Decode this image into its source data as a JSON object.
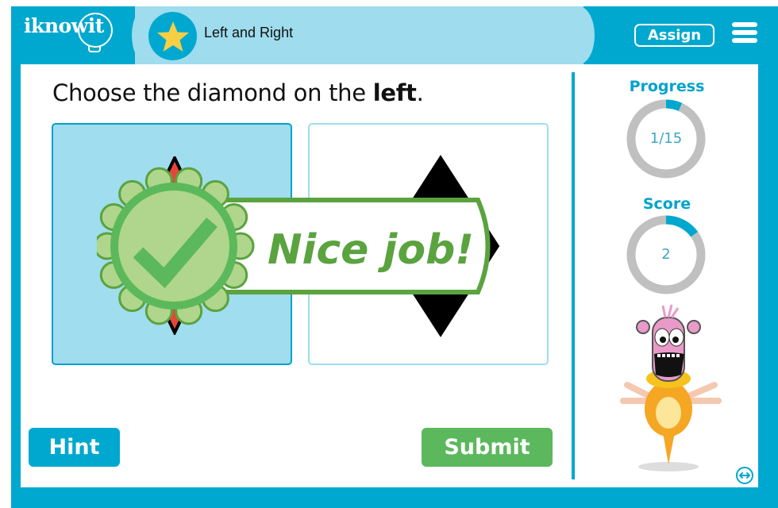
{
  "header": {
    "logo_text": "iknowit",
    "lesson_title": "Left and Right",
    "lesson_icon": "star-icon",
    "assign_label": "Assign",
    "menu_icon": "hamburger-menu-icon"
  },
  "question": {
    "prefix": "Choose the diamond on the ",
    "emphasis": "left",
    "suffix": "."
  },
  "choices": [
    {
      "shape": "diamond",
      "fill_color": "#e8453a",
      "outline_color": "#000000",
      "selected": true,
      "position": "left"
    },
    {
      "shape": "diamond",
      "fill_color": "#000000",
      "outline_color": "#000000",
      "selected": false,
      "position": "right"
    }
  ],
  "feedback": {
    "message": "Nice job!",
    "icon": "check-badge-icon",
    "color": "#5aa33f"
  },
  "buttons": {
    "hint_label": "Hint",
    "submit_label": "Submit"
  },
  "sidebar": {
    "progress_label": "Progress",
    "progress_text": "1/15",
    "progress_current": 1,
    "progress_total": 15,
    "score_label": "Score",
    "score_text": "2",
    "score_fraction": 0.15,
    "mascot": "monster-mascot",
    "expand_icon": "expand-arrows-icon"
  },
  "colors": {
    "brand": "#00a8cf",
    "header_highlight": "#9edcee",
    "selected_card": "#a0ddee",
    "submit": "#5cb85c",
    "ring_track": "#c0c0c0"
  }
}
